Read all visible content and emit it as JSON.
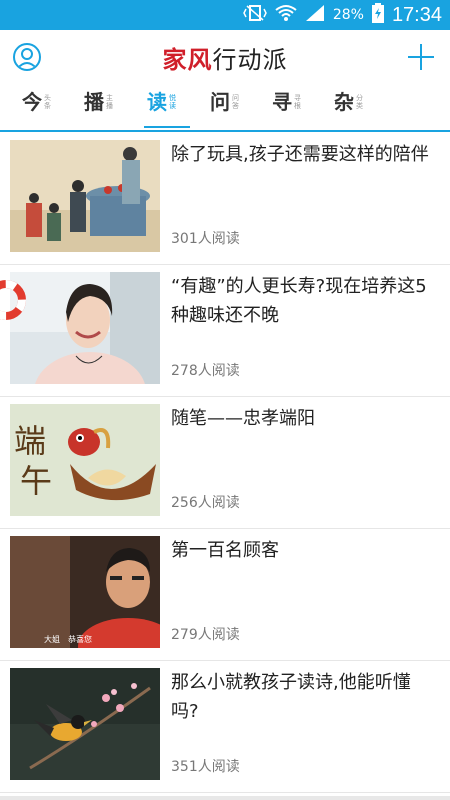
{
  "status_bar": {
    "battery": "28%",
    "time": "17:34"
  },
  "header": {
    "title_part1": "家风",
    "title_part2": "行动派"
  },
  "tabs": [
    {
      "label": "今",
      "sub": "头条"
    },
    {
      "label": "播",
      "sub": "主播"
    },
    {
      "label": "读",
      "sub": "悦读"
    },
    {
      "label": "问",
      "sub": "问答"
    },
    {
      "label": "寻",
      "sub": "寻根"
    },
    {
      "label": "杂",
      "sub": "分类"
    }
  ],
  "active_tab": "读",
  "articles": [
    {
      "title": "除了玩具,孩子还需要这样的陪伴",
      "reads": "301人阅读"
    },
    {
      "title": "“有趣”的人更长寿?现在培养这5种趣味还不晚",
      "reads": "278人阅读"
    },
    {
      "title": "随笔——忠孝端阳",
      "reads": "256人阅读"
    },
    {
      "title": "第一百名顾客",
      "reads": "279人阅读"
    },
    {
      "title": "那么小就教孩子读诗,他能听懂吗?",
      "reads": "351人阅读"
    }
  ],
  "thumb_text": {
    "duanwu_1": "端",
    "duanwu_2": "午",
    "subtitle_name": "大姐",
    "subtitle_text": "恭喜您"
  },
  "colors": {
    "accent": "#19a3e0",
    "brand_red": "#d01f2a"
  },
  "icons": [
    "wifi-icon",
    "signal-icon",
    "battery-icon",
    "vibrate-icon",
    "user-icon",
    "plus-icon",
    "lifebuoy-icon"
  ]
}
